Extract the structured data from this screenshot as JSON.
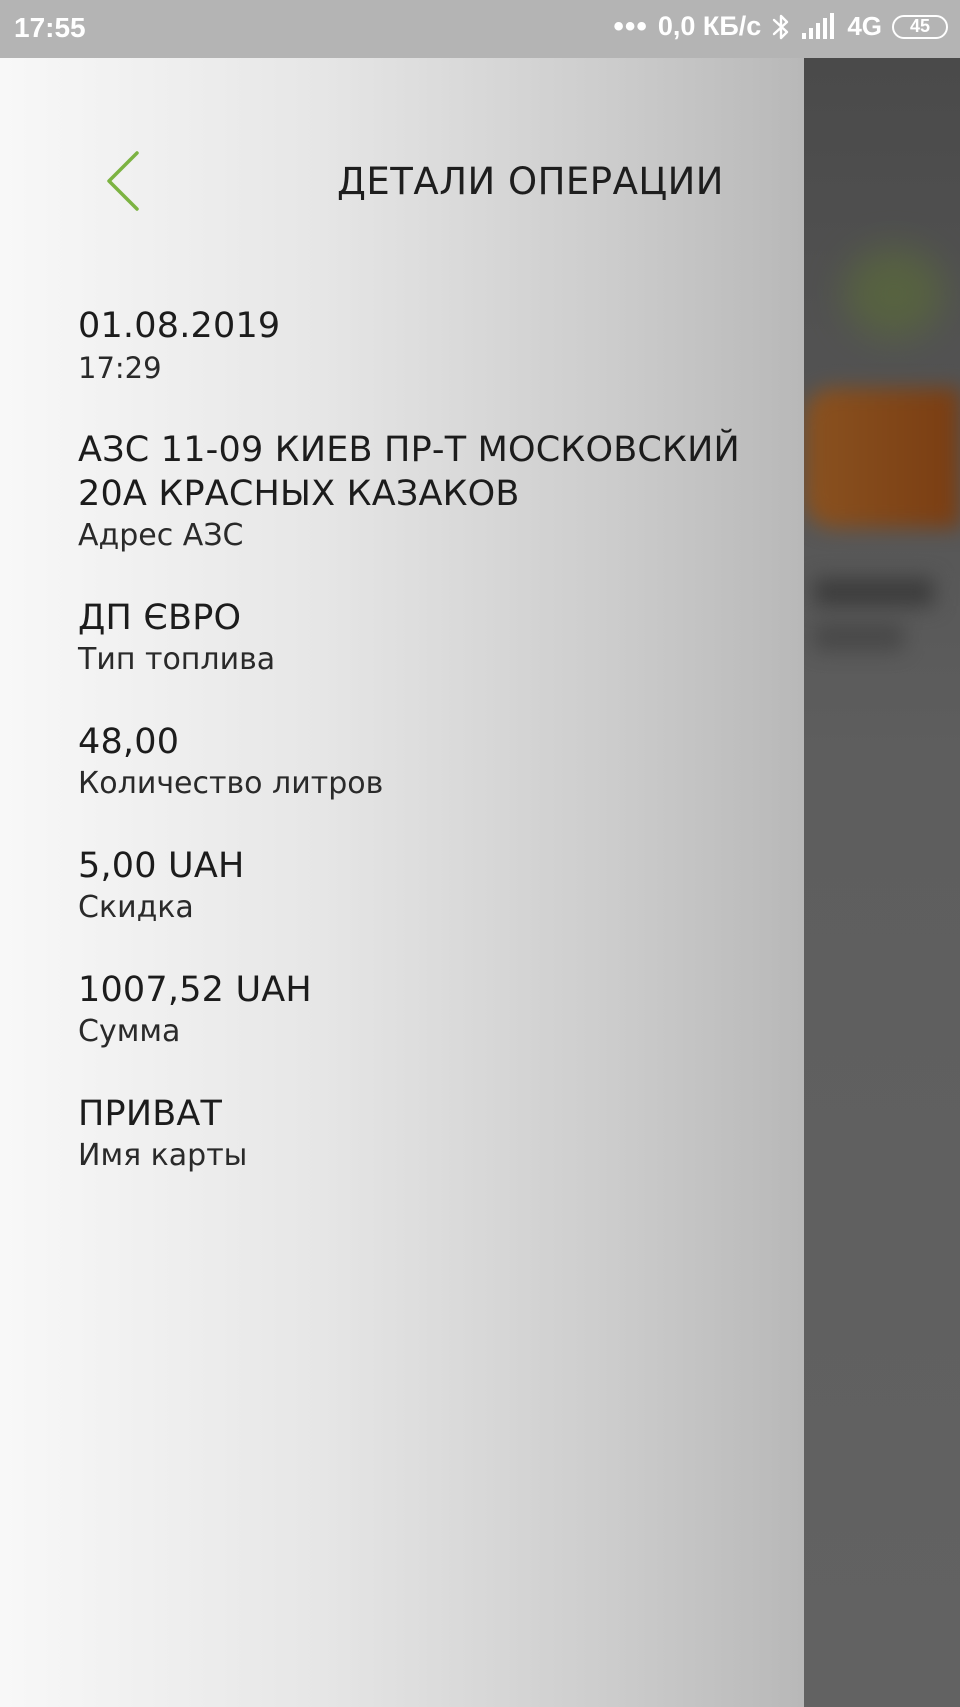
{
  "status_bar": {
    "time": "17:55",
    "dots": "•••",
    "network_speed": "0,0 КБ/с",
    "network_type": "4G",
    "battery": "45"
  },
  "header": {
    "title": "ДЕТАЛИ ОПЕРАЦИИ"
  },
  "accent_color": "#7cb342",
  "details": {
    "date": "01.08.2019",
    "time": "17:29",
    "station_address": "АЗС 11-09 КИЕВ ПР-Т МОСКОВСКИЙ 20А КРАСНЫХ КАЗАКОВ",
    "station_address_label": "Адрес АЗС",
    "fuel_type": "ДП ЄВРО",
    "fuel_type_label": "Тип топлива",
    "liters": "48,00",
    "liters_label": "Количество литров",
    "discount": "5,00 UAH",
    "discount_label": "Скидка",
    "amount": "1007,52 UAH",
    "amount_label": "Сумма",
    "card_name": "ПРИВАТ",
    "card_name_label": "Имя карты"
  }
}
